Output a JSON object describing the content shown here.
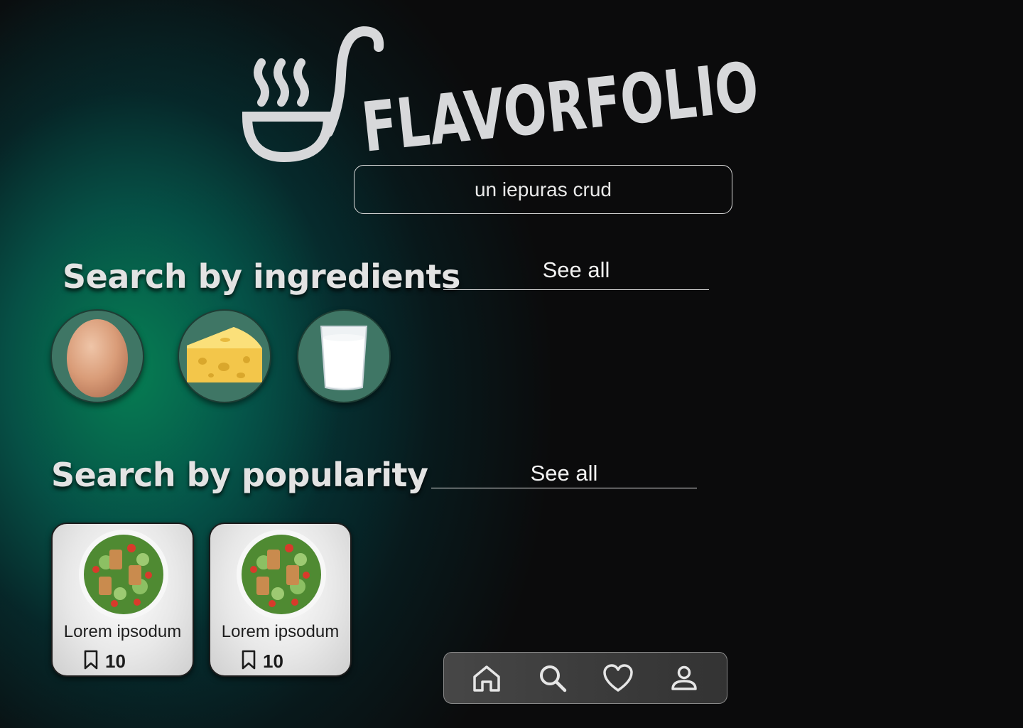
{
  "brand": {
    "name": "FLAVORFOLIO"
  },
  "search": {
    "value": "un iepuras crud"
  },
  "ingredients_section": {
    "title": "Search by ingredients",
    "see_all": "See all",
    "items": [
      {
        "name": "egg",
        "icon": "egg-icon"
      },
      {
        "name": "cheese",
        "icon": "cheese-icon"
      },
      {
        "name": "milk",
        "icon": "milk-glass-icon"
      }
    ]
  },
  "popularity_section": {
    "title": "Search by popularity",
    "see_all": "See all",
    "cards": [
      {
        "title": "Lorem ipsodum",
        "saves": "10"
      },
      {
        "title": "Lorem ipsodum",
        "saves": "10"
      }
    ]
  },
  "nav": {
    "items": [
      {
        "icon": "home-icon"
      },
      {
        "icon": "search-icon"
      },
      {
        "icon": "heart-icon"
      },
      {
        "icon": "profile-icon"
      }
    ]
  },
  "colors": {
    "background": "#0b0b0c",
    "glow": "#06825a",
    "text": "#e3e3e3",
    "ingredient_circle": "#3f7665",
    "card": "#e8e8e8"
  }
}
